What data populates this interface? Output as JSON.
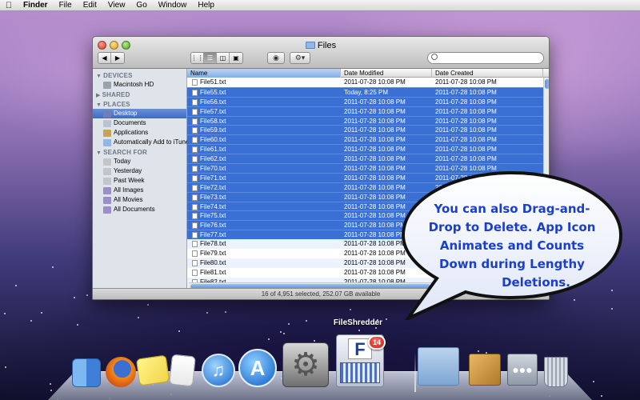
{
  "menubar": {
    "app": "Finder",
    "items": [
      "File",
      "Edit",
      "View",
      "Go",
      "Window",
      "Help"
    ]
  },
  "window": {
    "title": "Files",
    "search_placeholder": "",
    "status": "16 of 4,951 selected, 252.07 GB available"
  },
  "sidebar": {
    "sections": [
      {
        "title": "DEVICES",
        "items": [
          {
            "label": "Macintosh HD",
            "icon": "hard-drive-icon",
            "color": "#9aa3ad"
          }
        ]
      },
      {
        "title": "SHARED",
        "items": []
      },
      {
        "title": "PLACES",
        "items": [
          {
            "label": "Desktop",
            "icon": "desktop-icon",
            "color": "#6d7fb5",
            "selected": true
          },
          {
            "label": "Documents",
            "icon": "documents-icon",
            "color": "#b9c3d6"
          },
          {
            "label": "Applications",
            "icon": "applications-icon",
            "color": "#c7a35a"
          },
          {
            "label": "Automatically Add to iTunes",
            "icon": "folder-icon",
            "color": "#8fb8e6"
          }
        ]
      },
      {
        "title": "SEARCH FOR",
        "items": [
          {
            "label": "Today",
            "icon": "clock-icon",
            "color": "#c2c6cc"
          },
          {
            "label": "Yesterday",
            "icon": "clock-icon",
            "color": "#c2c6cc"
          },
          {
            "label": "Past Week",
            "icon": "clock-icon",
            "color": "#c2c6cc"
          },
          {
            "label": "All Images",
            "icon": "smart-folder-icon",
            "color": "#9a8fc9"
          },
          {
            "label": "All Movies",
            "icon": "smart-folder-icon",
            "color": "#9a8fc9"
          },
          {
            "label": "All Documents",
            "icon": "smart-folder-icon",
            "color": "#9a8fc9"
          }
        ]
      }
    ]
  },
  "columns": [
    "Name",
    "Date Modified",
    "Date Created"
  ],
  "files": [
    {
      "name": "File51.txt",
      "modified": "2011-07-28 10:08 PM",
      "created": "2011-07-28 10:08 PM",
      "selected": false
    },
    {
      "name": "File55.txt",
      "modified": "Today, 8:25 PM",
      "created": "2011-07-28 10:08 PM",
      "selected": true
    },
    {
      "name": "File56.txt",
      "modified": "2011-07-28 10:08 PM",
      "created": "2011-07-28 10:08 PM",
      "selected": true
    },
    {
      "name": "File57.txt",
      "modified": "2011-07-28 10:08 PM",
      "created": "2011-07-28 10:08 PM",
      "selected": true
    },
    {
      "name": "File58.txt",
      "modified": "2011-07-28 10:08 PM",
      "created": "2011-07-28 10:08 PM",
      "selected": true
    },
    {
      "name": "File59.txt",
      "modified": "2011-07-28 10:08 PM",
      "created": "2011-07-28 10:08 PM",
      "selected": true
    },
    {
      "name": "File60.txt",
      "modified": "2011-07-28 10:08 PM",
      "created": "2011-07-28 10:08 PM",
      "selected": true
    },
    {
      "name": "File61.txt",
      "modified": "2011-07-28 10:08 PM",
      "created": "2011-07-28 10:08 PM",
      "selected": true
    },
    {
      "name": "File62.txt",
      "modified": "2011-07-28 10:08 PM",
      "created": "2011-07-28 10:08 PM",
      "selected": true
    },
    {
      "name": "File70.txt",
      "modified": "2011-07-28 10:08 PM",
      "created": "2011-07-28 10:08 PM",
      "selected": true
    },
    {
      "name": "File71.txt",
      "modified": "2011-07-28 10:08 PM",
      "created": "2011-07-28 10:08 PM",
      "selected": true
    },
    {
      "name": "File72.txt",
      "modified": "2011-07-28 10:08 PM",
      "created": "2011-07-28 10:08 PM",
      "selected": true
    },
    {
      "name": "File73.txt",
      "modified": "2011-07-28 10:08 PM",
      "created": "2011-07-28 10:08 PM",
      "selected": true
    },
    {
      "name": "File74.txt",
      "modified": "2011-07-28 10:08 PM",
      "created": "2011-07-28 10:08 PM",
      "selected": true
    },
    {
      "name": "File75.txt",
      "modified": "2011-07-28 10:08 PM",
      "created": "2011-07-28 10:08 PM",
      "selected": true
    },
    {
      "name": "File76.txt",
      "modified": "2011-07-28 10:08 PM",
      "created": "2011-07-28 10:08 PM",
      "selected": true
    },
    {
      "name": "File77.txt",
      "modified": "2011-07-28 10:08 PM",
      "created": "2011-07-28 10:08 PM",
      "selected": true
    },
    {
      "name": "File78.txt",
      "modified": "2011-07-28 10:08 PM",
      "created": "2011-07-28 10:08 PM",
      "selected": false
    },
    {
      "name": "File79.txt",
      "modified": "2011-07-28 10:08 PM",
      "created": "2011-07-28 10:08 PM",
      "selected": false
    },
    {
      "name": "File80.txt",
      "modified": "2011-07-28 10:08 PM",
      "created": "2011-07-28 10:08 PM",
      "selected": false
    },
    {
      "name": "File81.txt",
      "modified": "2011-07-28 10:08 PM",
      "created": "2011-07-28 10:08 PM",
      "selected": false
    },
    {
      "name": "File82.txt",
      "modified": "2011-07-28 10:08 PM",
      "created": "2011-07-28 10:08 PM",
      "selected": false
    }
  ],
  "bubble": {
    "lines": [
      "You can also Drag-and-",
      "Drop to Delete. App Icon",
      "Animates and Counts",
      "Down during Lengthy",
      "Deletions."
    ],
    "text_color": "#1a3ecf"
  },
  "dock": {
    "label": "FileShredder",
    "badge": "14",
    "apps": [
      "finder-icon",
      "firefox-icon",
      "stickies-icon",
      "textedit-icon",
      "itunes-icon",
      "app-store-icon",
      "system-preferences-icon",
      "fileshredder-icon",
      "documents-stack-icon",
      "package-icon",
      "shared-folder-icon",
      "trash-icon"
    ]
  },
  "colors": {
    "selection": "#3a70d4",
    "sidebar_bg": "#dfe4ea",
    "badge": "#c91a12"
  }
}
